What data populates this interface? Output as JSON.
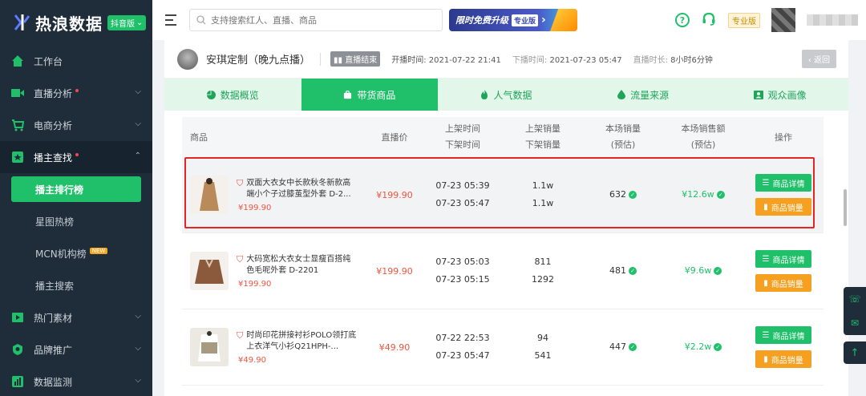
{
  "app": {
    "logo_text": "热浪数据",
    "platform_badge": "抖音版"
  },
  "sidebar": {
    "items": [
      {
        "label": "工作台",
        "icon": "home-icon"
      },
      {
        "label": "直播分析",
        "icon": "live-icon",
        "dot": true
      },
      {
        "label": "电商分析",
        "icon": "cart-icon"
      },
      {
        "label": "播主查找",
        "icon": "search-user-icon",
        "dot": true
      }
    ],
    "sub_items": [
      {
        "label": "播主排行榜",
        "active": true
      },
      {
        "label": "星图热榜"
      },
      {
        "label": "MCN机构榜",
        "badge": "NEW"
      },
      {
        "label": "播主搜索"
      }
    ],
    "items_after": [
      {
        "label": "热门素材",
        "icon": "media-icon"
      },
      {
        "label": "品牌推广",
        "icon": "brand-icon"
      },
      {
        "label": "数据监测",
        "icon": "chart-icon"
      }
    ]
  },
  "topbar": {
    "search_placeholder": "支持搜索红人、直播、商品",
    "promo_text": "限时免费升级",
    "promo_tag": "专业版",
    "pro_badge": "专业版"
  },
  "host": {
    "name": "安琪定制（晚九点播）",
    "live_status": "直播结束",
    "start_label": "开播时间:",
    "start_time": "2021-07-22 21:41",
    "end_label": "下播时间:",
    "end_time": "2021-07-23 05:47",
    "duration_label": "直播时长:",
    "duration": "8小时6分钟",
    "back_label": "返回"
  },
  "tabs": [
    {
      "label": "数据概览",
      "icon": "pie-icon"
    },
    {
      "label": "带货商品",
      "icon": "bag-icon",
      "active": true
    },
    {
      "label": "人气数据",
      "icon": "flame-icon"
    },
    {
      "label": "流量来源",
      "icon": "drop-icon"
    },
    {
      "label": "观众画像",
      "icon": "portrait-icon"
    }
  ],
  "table": {
    "headers": {
      "product": "商品",
      "live_price": "直播价",
      "shelf_time_1": "上架时间",
      "shelf_time_2": "下架时间",
      "shelf_sales_1": "上架销量",
      "shelf_sales_2": "下架销量",
      "session_sales_1": "本场销量",
      "session_sales_2": "(预估)",
      "session_revenue_1": "本场销售额",
      "session_revenue_2": "(预估)",
      "actions": "操作"
    },
    "rows": [
      {
        "title": "双面大衣女中长款秋冬新款高端小个子过膝茧型外套 D-2...",
        "price": "¥199.90",
        "live_price": "¥199.90",
        "on_time": "07-23 05:39",
        "off_time": "07-23 05:47",
        "on_sales": "1.1w",
        "off_sales": "1.1w",
        "session_sales": "632",
        "session_revenue": "¥12.6w",
        "thumb_color": "#b98a5a"
      },
      {
        "title": "大码宽松大衣女士显瘦百搭纯色毛呢外套 D-2201",
        "price": "¥199.90",
        "live_price": "¥199.90",
        "on_time": "07-23 05:03",
        "off_time": "07-23 05:15",
        "on_sales": "811",
        "off_sales": "1292",
        "session_sales": "481",
        "session_revenue": "¥9.6w",
        "thumb_color": "#8b5a3c"
      },
      {
        "title": "时尚印花拼接衬衫POLO领打底上衣洋气小衫Q21HPH-...",
        "price": "¥49.90",
        "live_price": "¥49.90",
        "on_time": "07-22 22:53",
        "off_time": "07-23 05:47",
        "on_sales": "94",
        "off_sales": "541",
        "session_sales": "447",
        "session_revenue": "¥2.2w",
        "thumb_color": "#d8d4cc"
      }
    ],
    "detail_button": "商品详情",
    "sales_button": "商品销量"
  },
  "colors": {
    "brand_green": "#20c06a",
    "sidebar_bg": "#1f2d3a",
    "price_red": "#f0553f",
    "action_orange": "#f5a020"
  }
}
